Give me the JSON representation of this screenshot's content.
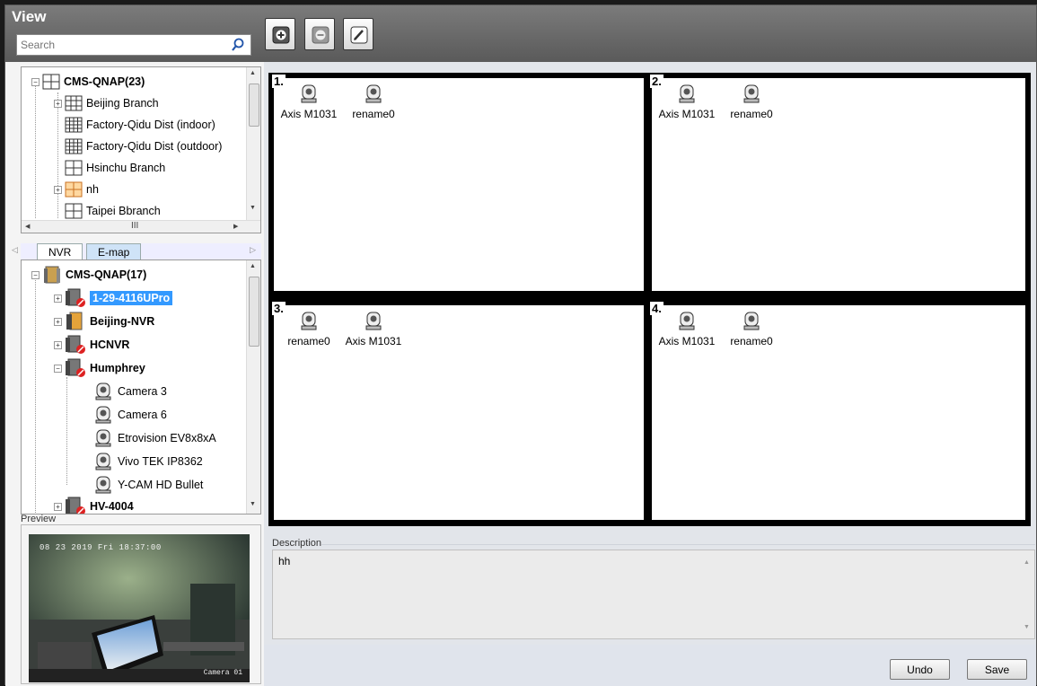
{
  "header": {
    "title": "View",
    "search_placeholder": "Search"
  },
  "toolbar": {
    "add": "add-view",
    "remove": "remove-view",
    "edit": "edit-view"
  },
  "view_tree": {
    "root": "CMS-QNAP(23)",
    "items": [
      "Beijing Branch",
      "Factory-Qidu Dist  (indoor)",
      "Factory-Qidu Dist  (outdoor)",
      "Hsinchu Branch",
      "nh",
      "Taipei Bbranch"
    ],
    "hscroll_mark": "III"
  },
  "tabs": {
    "nvr": "NVR",
    "emap": "E-map"
  },
  "nvr_tree": {
    "root": "CMS-QNAP(17)",
    "nodes": [
      "1-29-4116UPro",
      "Beijing-NVR",
      "HCNVR",
      "Humphrey"
    ],
    "cameras": [
      "Camera 3",
      "Camera 6",
      "Etrovision EV8x8xA",
      "Vivo TEK IP8362",
      "Y-CAM HD Bullet"
    ],
    "last": "HV-4004"
  },
  "preview": {
    "label": "Preview",
    "osd_time": "08 23 2019 Fri 18:37:00",
    "osd_name": "Camera 01"
  },
  "layout": {
    "cells": [
      {
        "num": "1.",
        "cams": [
          "Axis M1031",
          "rename0"
        ]
      },
      {
        "num": "2.",
        "cams": [
          "Axis M1031",
          "rename0"
        ]
      },
      {
        "num": "3.",
        "cams": [
          "rename0",
          "Axis M1031"
        ]
      },
      {
        "num": "4.",
        "cams": [
          "Axis M1031",
          "rename0"
        ]
      }
    ]
  },
  "description": {
    "label": "Description",
    "text": "hh"
  },
  "footer": {
    "undo": "Undo",
    "save": "Save"
  },
  "colors": {
    "selected": "#3399ff",
    "accent_orange": "#f0a040"
  }
}
